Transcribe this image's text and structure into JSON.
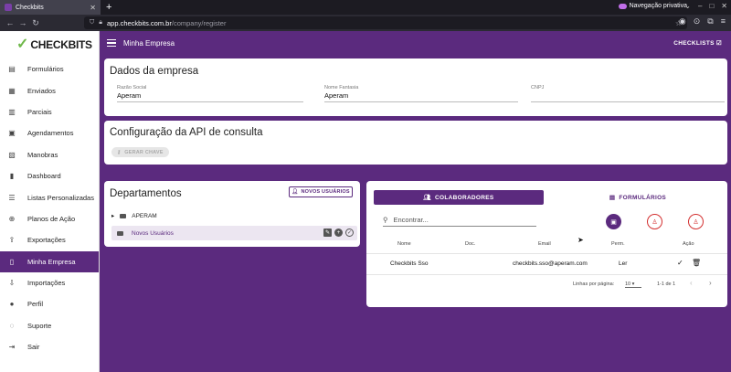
{
  "browser": {
    "tab_title": "Checkbits",
    "url_host": "app.checkbits.com.br",
    "url_path": "/company/register",
    "private_label": "Navegação privativa"
  },
  "brand": {
    "name": "CHECKBITS"
  },
  "sidebar": {
    "items": [
      {
        "label": "Formulários",
        "icon": "form-icon"
      },
      {
        "label": "Enviados",
        "icon": "sent-icon"
      },
      {
        "label": "Parciais",
        "icon": "partial-icon"
      },
      {
        "label": "Agendamentos",
        "icon": "calendar-icon"
      },
      {
        "label": "Manobras",
        "icon": "maneuver-icon"
      },
      {
        "label": "Dashboard",
        "icon": "dashboard-icon"
      },
      {
        "label": "Listas Personalizadas",
        "icon": "list-icon"
      },
      {
        "label": "Planos de Ação",
        "icon": "target-icon"
      },
      {
        "label": "Exportações",
        "icon": "export-icon"
      },
      {
        "label": "Minha Empresa",
        "icon": "company-icon"
      },
      {
        "label": "Importações",
        "icon": "import-icon"
      },
      {
        "label": "Perfil",
        "icon": "person-icon"
      },
      {
        "label": "Suporte",
        "icon": "chat-icon"
      },
      {
        "label": "Sair",
        "icon": "logout-icon"
      }
    ],
    "active": "Minha Empresa"
  },
  "header": {
    "title": "Minha Empresa",
    "checklists_label": "CHECKLISTS"
  },
  "company": {
    "title": "Dados da empresa",
    "razao_label": "Razão Social",
    "razao_value": "Aperam",
    "fantasia_label": "Nome Fantasia",
    "fantasia_value": "Aperam",
    "cnpj_label": "CNPJ",
    "cnpj_value": ""
  },
  "api": {
    "title": "Configuração da API de consulta",
    "key_button": "GERAR CHAVE"
  },
  "departments": {
    "title": "Departamentos",
    "new_users_button": "NOVOS USUÁRIOS",
    "root": "APERAM",
    "child": "Novos Usuários"
  },
  "collab": {
    "tab_collaborators": "COLABORADORES",
    "tab_forms": "FORMULÁRIOS",
    "search_placeholder": "Encontrar...",
    "columns": {
      "name": "Nome",
      "doc": "Doc.",
      "email": "Email",
      "perm": "Perm.",
      "action": "Ação"
    },
    "rows": [
      {
        "name": "Checkbits Sso",
        "doc": "",
        "email": "checkbits.sso@aperam.com",
        "perm": "Ler"
      }
    ],
    "rows_per_page_label": "Linhas por página:",
    "rows_per_page": "10",
    "range": "1-1 de 1"
  },
  "colors": {
    "primary": "#5b2a7e",
    "danger": "#d32f2f",
    "brand_green": "#6fb84a"
  }
}
